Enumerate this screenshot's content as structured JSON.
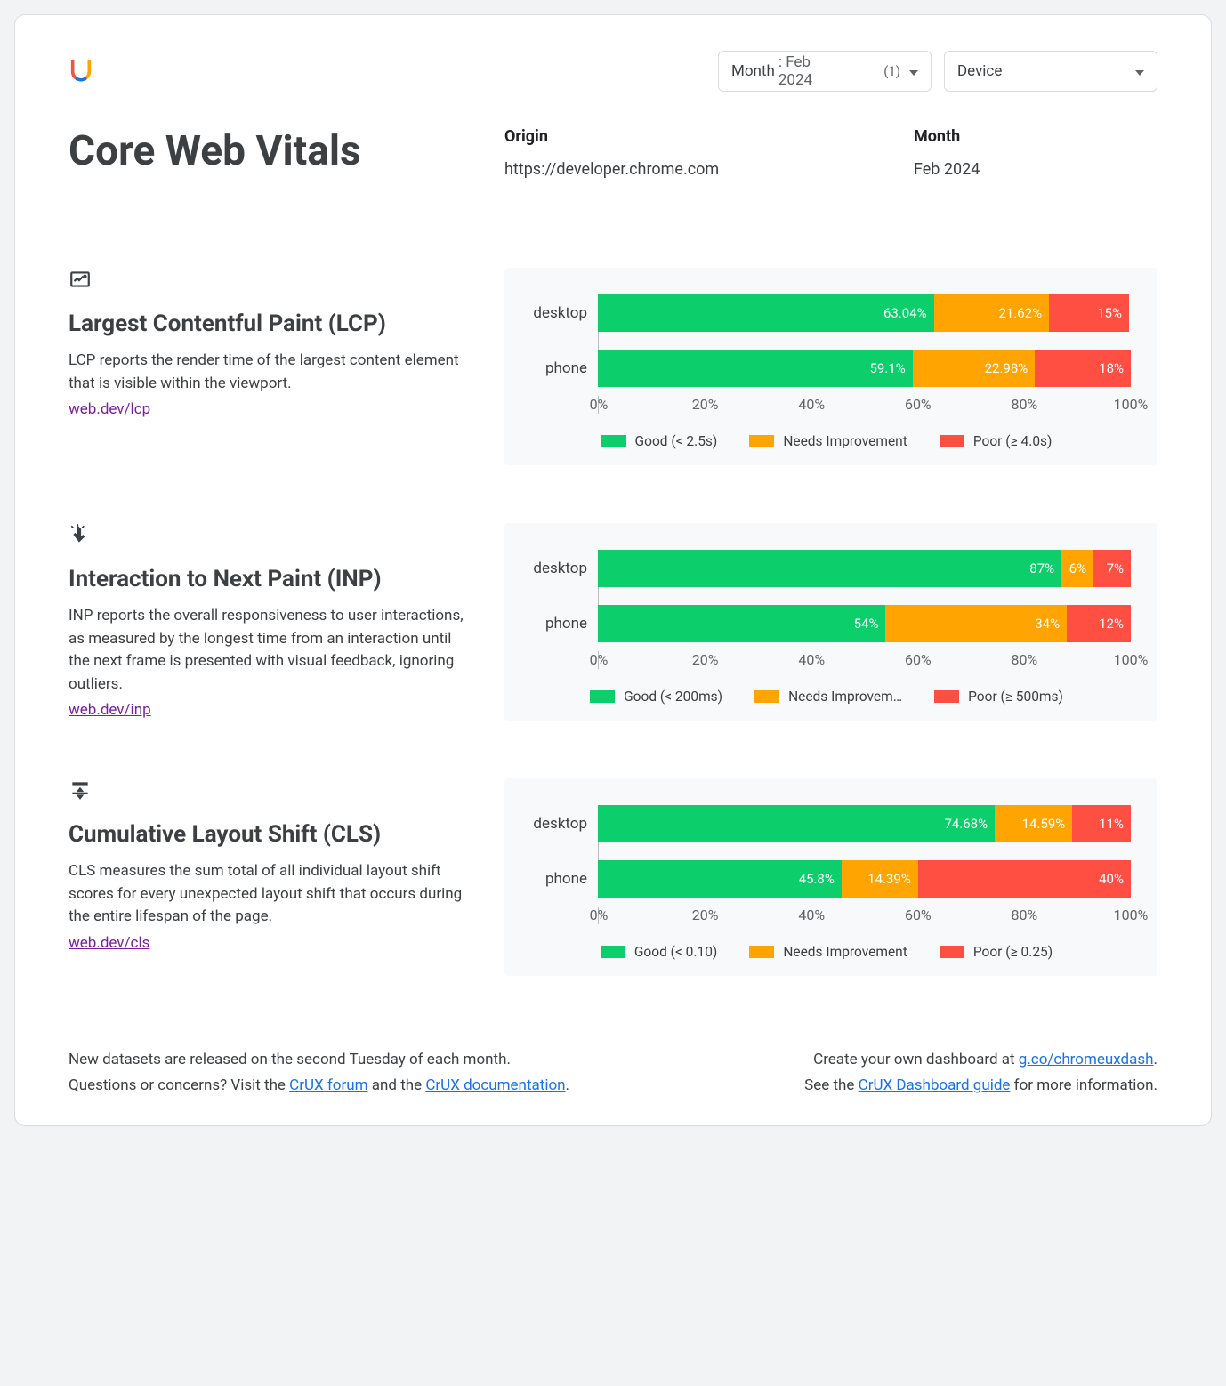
{
  "filters": {
    "month_label": "Month",
    "month_value": ": Feb 2024",
    "month_count": "(1)",
    "device_label": "Device"
  },
  "header": {
    "title": "Core Web Vitals",
    "origin_label": "Origin",
    "origin_value": "https://developer.chrome.com",
    "month_label": "Month",
    "month_value": "Feb 2024"
  },
  "axis_ticks": [
    "0%",
    "20%",
    "40%",
    "60%",
    "80%",
    "100%"
  ],
  "legend_colors": {
    "good": "#0cce6b",
    "ni": "#ffa400",
    "poor": "#ff4e42"
  },
  "metrics": [
    {
      "key": "lcp",
      "title": "Largest Contentful Paint (LCP)",
      "desc": "LCP reports the render time of the largest content element that is visible within the viewport.",
      "link": "web.dev/lcp",
      "legend": {
        "good": "Good (< 2.5s)",
        "ni": "Needs Improvement",
        "poor": "Poor (≥ 4.0s)"
      }
    },
    {
      "key": "inp",
      "title": "Interaction to Next Paint (INP)",
      "desc": "INP reports the overall responsiveness to user interactions, as measured by the longest time from an interaction until the next frame is presented with visual feedback, ignoring outliers.",
      "link": "web.dev/inp",
      "legend": {
        "good": "Good (< 200ms)",
        "ni": "Needs Improvem…",
        "poor": "Poor (≥ 500ms)"
      }
    },
    {
      "key": "cls",
      "title": "Cumulative Layout Shift (CLS)",
      "desc": "CLS measures the sum total of all individual layout shift scores for every unexpected layout shift that occurs during the entire lifespan of the page.",
      "link": "web.dev/cls",
      "legend": {
        "good": "Good (< 0.10)",
        "ni": "Needs Improvement",
        "poor": "Poor (≥ 0.25)"
      }
    }
  ],
  "chart_data": [
    {
      "metric": "lcp",
      "type": "bar",
      "title": "Largest Contentful Paint (LCP)",
      "categories": [
        "desktop",
        "phone"
      ],
      "series": [
        {
          "name": "Good (< 2.5s)",
          "values": [
            63.04,
            59.1
          ],
          "labels": [
            "63.04%",
            "59.1%"
          ]
        },
        {
          "name": "Needs Improvement",
          "values": [
            21.62,
            22.98
          ],
          "labels": [
            "21.62%",
            "22.98%"
          ]
        },
        {
          "name": "Poor (≥ 4.0s)",
          "values": [
            15,
            18
          ],
          "labels": [
            "15%",
            "18%"
          ]
        }
      ],
      "xlim": [
        0,
        100
      ],
      "xticks": [
        0,
        20,
        40,
        60,
        80,
        100
      ]
    },
    {
      "metric": "inp",
      "type": "bar",
      "title": "Interaction to Next Paint (INP)",
      "categories": [
        "desktop",
        "phone"
      ],
      "series": [
        {
          "name": "Good (< 200ms)",
          "values": [
            87,
            54
          ],
          "labels": [
            "87%",
            "54%"
          ]
        },
        {
          "name": "Needs Improvement",
          "values": [
            6,
            34
          ],
          "labels": [
            "6%",
            "34%"
          ]
        },
        {
          "name": "Poor (≥ 500ms)",
          "values": [
            7,
            12
          ],
          "labels": [
            "7%",
            "12%"
          ]
        }
      ],
      "xlim": [
        0,
        100
      ],
      "xticks": [
        0,
        20,
        40,
        60,
        80,
        100
      ]
    },
    {
      "metric": "cls",
      "type": "bar",
      "title": "Cumulative Layout Shift (CLS)",
      "categories": [
        "desktop",
        "phone"
      ],
      "series": [
        {
          "name": "Good (< 0.10)",
          "values": [
            74.68,
            45.8
          ],
          "labels": [
            "74.68%",
            "45.8%"
          ]
        },
        {
          "name": "Needs Improvement",
          "values": [
            14.59,
            14.39
          ],
          "labels": [
            "14.59%",
            "14.39%"
          ]
        },
        {
          "name": "Poor (≥ 0.25)",
          "values": [
            11,
            40
          ],
          "labels": [
            "11%",
            "40%"
          ]
        }
      ],
      "xlim": [
        0,
        100
      ],
      "xticks": [
        0,
        20,
        40,
        60,
        80,
        100
      ]
    }
  ],
  "footer": {
    "left_line1": "New datasets are released on the second Tuesday of each month.",
    "left_line2_pre": "Questions or concerns? Visit the ",
    "left_link1": "CrUX forum",
    "left_line2_mid": " and the ",
    "left_link2": "CrUX documentation",
    "right_line1_pre": "Create your own dashboard at ",
    "right_link1": "g.co/chromeuxdash",
    "right_line2_pre": "See the ",
    "right_link2": "CrUX Dashboard guide",
    "right_line2_post": " for more information."
  }
}
